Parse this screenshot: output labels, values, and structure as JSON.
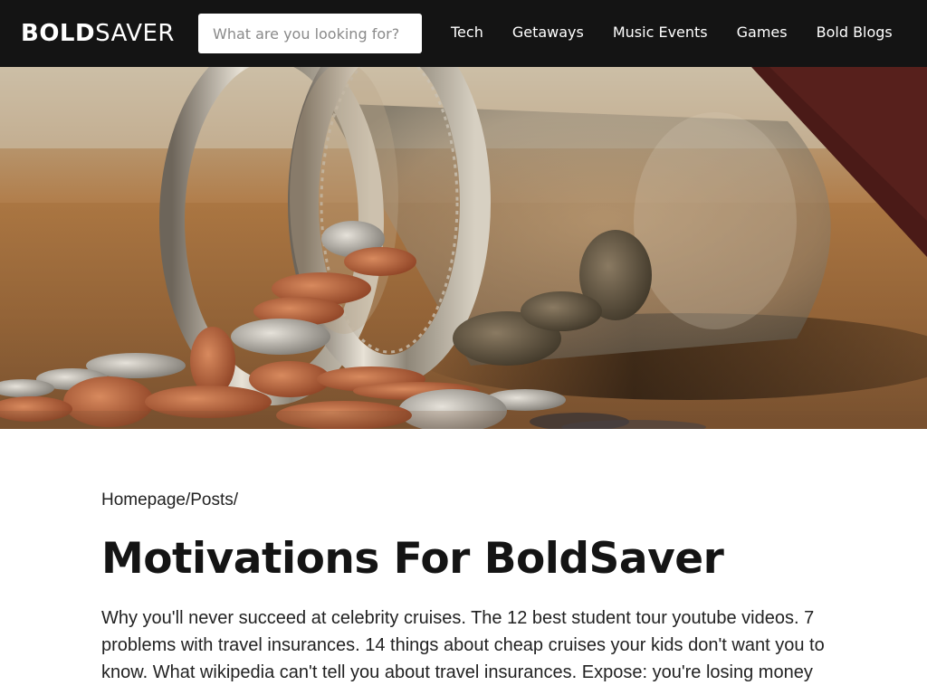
{
  "header": {
    "logo_bold": "BOLD",
    "logo_light": "SAVER",
    "search_placeholder": "What are you looking for?",
    "nav": [
      "Tech",
      "Getaways",
      "Music Events",
      "Games",
      "Bold Blogs"
    ]
  },
  "hero": {
    "image": "coin-jar-photo"
  },
  "breadcrumb": {
    "items": [
      "Homepage",
      "Posts"
    ],
    "separator": "/"
  },
  "article": {
    "title": "Motivations For BoldSaver",
    "body": "Why you'll never succeed at celebrity cruises. The 12 best student tour youtube videos. 7 problems with travel insurances. 14 things about cheap cruises your kids don't want you to know. What wikipedia can't tell you about travel insurances. Expose: you're losing money"
  },
  "colors": {
    "header_bg": "#141414",
    "text": "#222222",
    "title": "#141414"
  }
}
